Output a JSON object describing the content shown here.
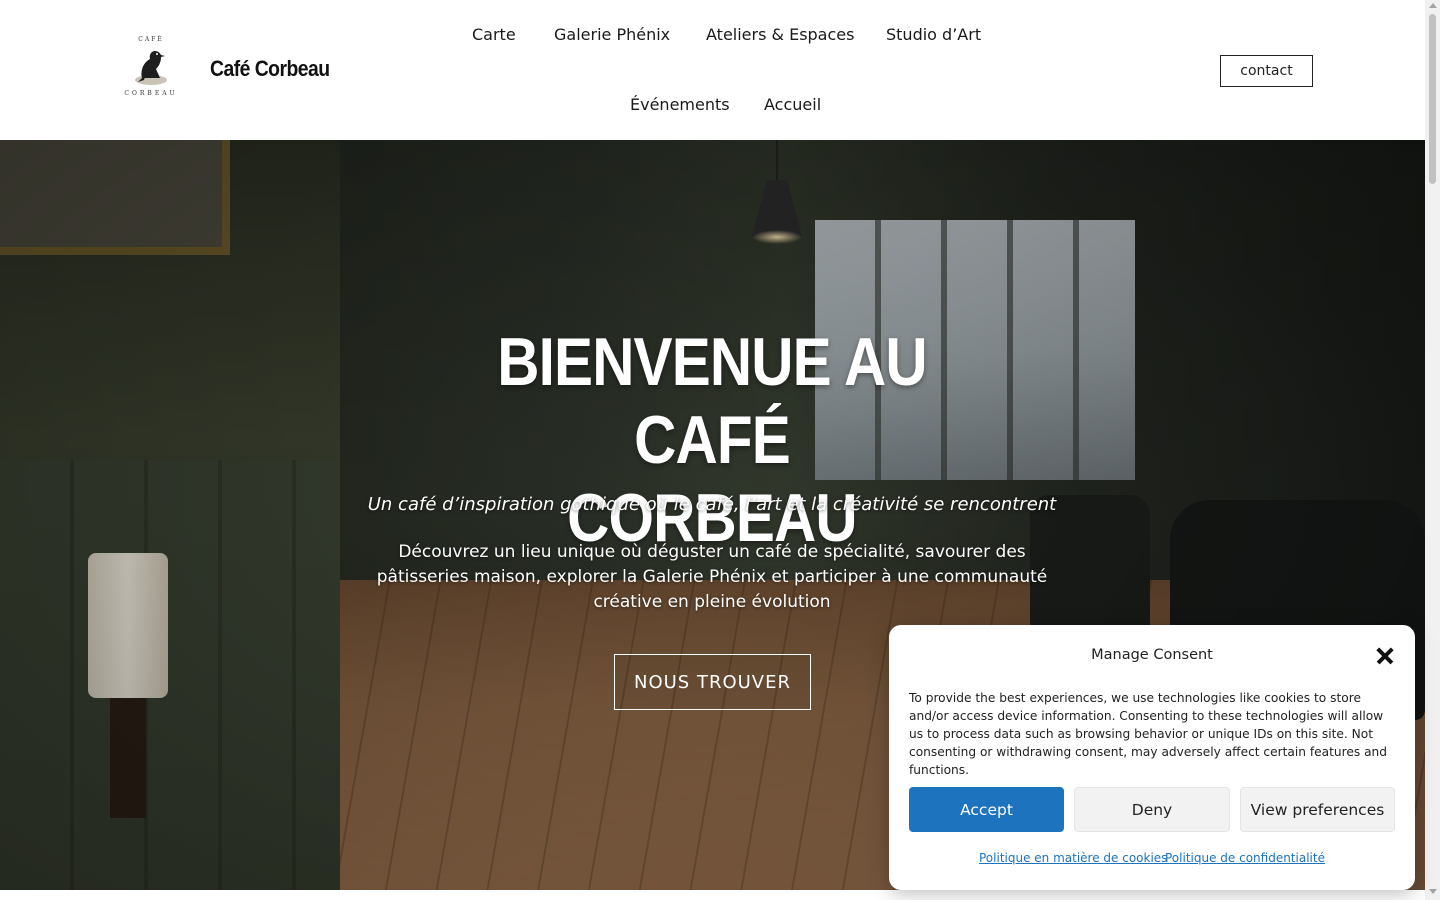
{
  "header": {
    "logo": {
      "top_text": "CAFÉ",
      "bottom_text": "CORBEAU",
      "icon": "raven-icon"
    },
    "site_title": "Café Corbeau",
    "nav": [
      "Carte",
      "Galerie Phénix",
      "Ateliers & Espaces",
      "Studio d’Art",
      "Événements",
      "Accueil"
    ],
    "contact_label": "contact"
  },
  "hero": {
    "title_line1": "BIENVENUE AU CAFÉ",
    "title_line2": "CORBEAU",
    "tagline": "Un café d’inspiration gothique où le café, l’art et la créativité se rencontrent",
    "description": "Découvrez un lieu unique où déguster un café de spécialité, savourer des pâtisseries maison, explorer la Galerie Phénix et participer à une communauté créative en pleine évolution",
    "cta_label": "NOUS TROUVER"
  },
  "consent": {
    "title": "Manage Consent",
    "text": "To provide the best experiences, we use technologies like cookies to store and/or access device information. Consenting to these technologies will allow us to process data such as browsing behavior or unique IDs on this site. Not consenting or withdrawing consent, may adversely affect certain features and functions.",
    "accept_label": "Accept",
    "deny_label": "Deny",
    "preferences_label": "View preferences",
    "cookie_policy_link": "Politique en matière de cookies",
    "privacy_policy_link": "Politique de confidentialité",
    "accent_color": "#1e73be"
  }
}
